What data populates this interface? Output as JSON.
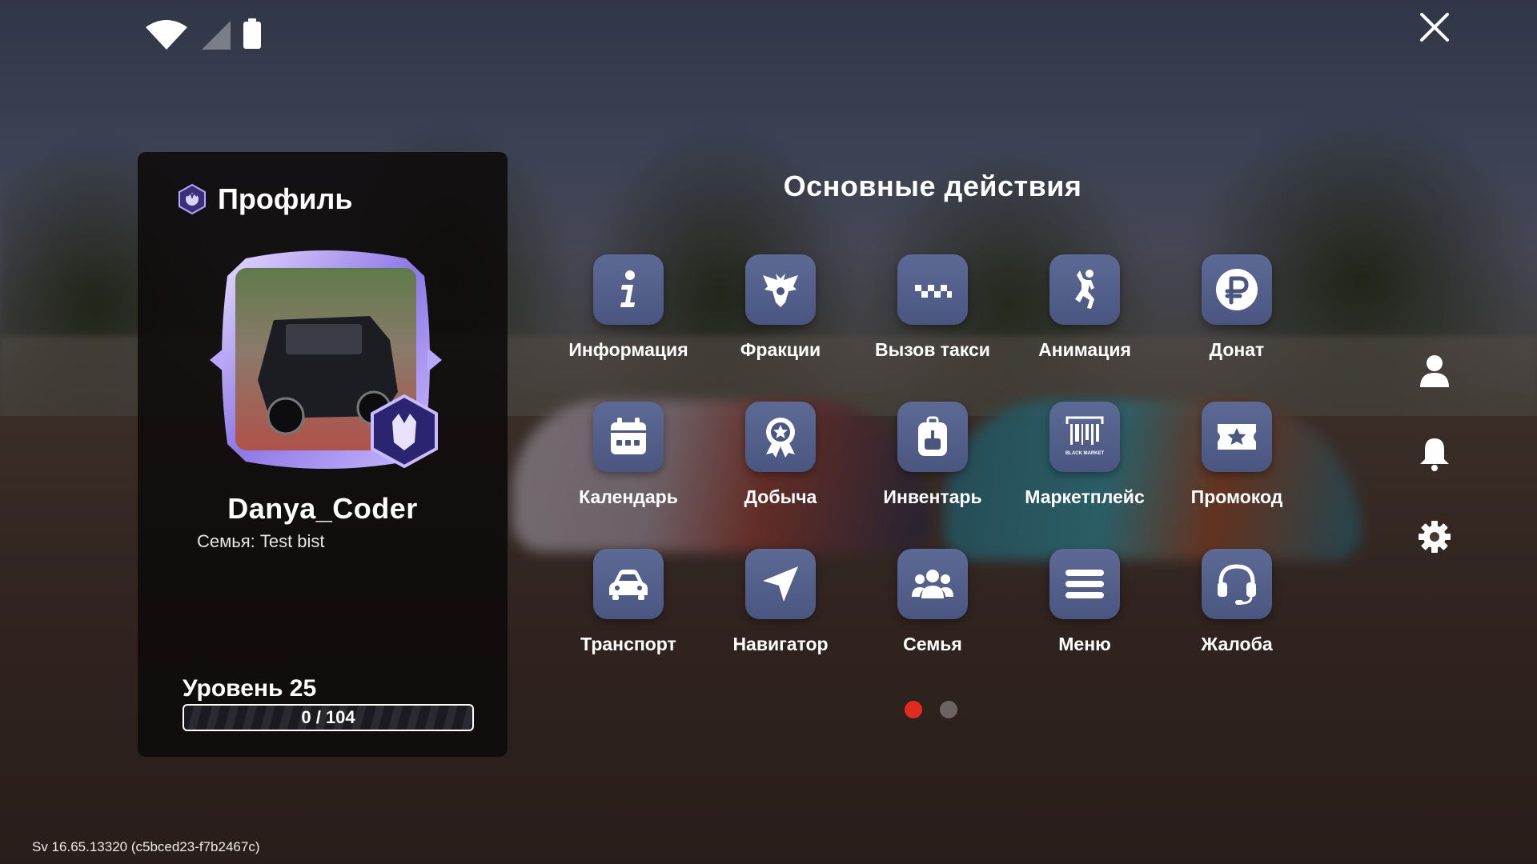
{
  "profile": {
    "title": "Профиль",
    "username": "Danya_Coder",
    "family": "Семья: Test bist",
    "level_label": "Уровень 25",
    "xp_text": "0 / 104",
    "xp_progress": 0
  },
  "actions": {
    "title": "Основные действия",
    "rows": [
      [
        {
          "label": "Информация",
          "icon": "info-icon"
        },
        {
          "label": "Фракции",
          "icon": "eagle-icon"
        },
        {
          "label": "Вызов такси",
          "icon": "taxi-checker-icon"
        },
        {
          "label": "Анимация",
          "icon": "dancing-person-icon"
        },
        {
          "label": "Донат",
          "icon": "ruble-icon"
        }
      ],
      [
        {
          "label": "Календарь",
          "icon": "calendar-icon"
        },
        {
          "label": "Добыча",
          "icon": "award-ribbon-icon"
        },
        {
          "label": "Инвентарь",
          "icon": "backpack-icon"
        },
        {
          "label": "Маркетплейс",
          "icon": "black-market-barcode-icon"
        },
        {
          "label": "Промокод",
          "icon": "ticket-star-icon"
        }
      ],
      [
        {
          "label": "Транспорт",
          "icon": "car-icon"
        },
        {
          "label": "Навигатор",
          "icon": "navigation-arrow-icon"
        },
        {
          "label": "Семья",
          "icon": "people-group-icon"
        },
        {
          "label": "Меню",
          "icon": "hamburger-menu-icon"
        },
        {
          "label": "Жалоба",
          "icon": "headset-icon"
        }
      ]
    ],
    "market_icon_text": "BLACK MARKET"
  },
  "pagination": {
    "pages": 2,
    "current": 1
  },
  "colors": {
    "tile_bg": "#5d6a95",
    "active_dot": "#e22a1f",
    "inactive_dot": "#6c6464",
    "panel_bg": "#0e0a0a"
  },
  "version": "Sv 16.65.13320 (c5bced23-f7b2467c)"
}
